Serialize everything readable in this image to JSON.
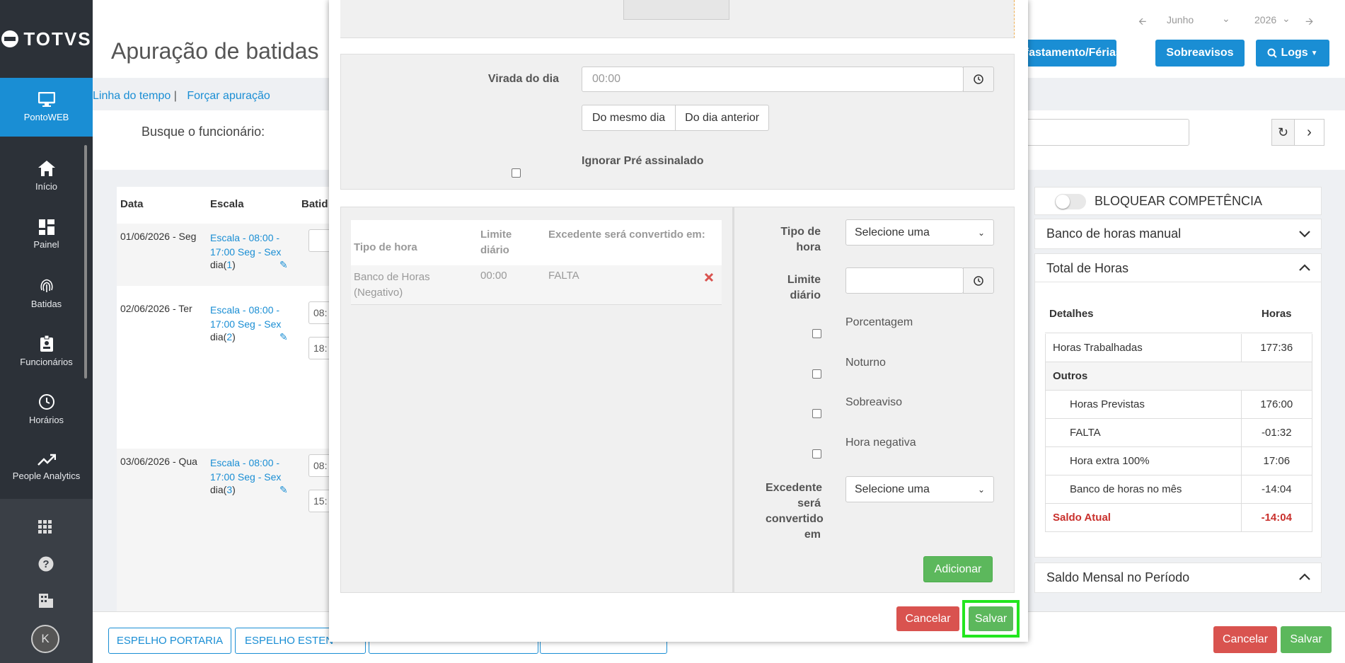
{
  "sidebar": {
    "brand": "TOTVS",
    "items": [
      {
        "label": "PontoWEB",
        "icon": "monitor-icon"
      },
      {
        "label": "Início",
        "icon": "home-icon"
      },
      {
        "label": "Painel",
        "icon": "dashboard-icon"
      },
      {
        "label": "Batidas",
        "icon": "fingerprint-icon"
      },
      {
        "label": "Funcionários",
        "icon": "badge-icon"
      },
      {
        "label": "Horários",
        "icon": "clock-icon"
      },
      {
        "label": "People Analytics",
        "icon": "trend-icon"
      }
    ],
    "avatar": "K"
  },
  "header": {
    "title": "Apuração de batidas",
    "month": "Junho",
    "year": "2026",
    "btn_afastamento": "Afastamento/Férias",
    "btn_sobreavisos": "Sobreavisos",
    "btn_logs": "Logs",
    "link_timeline": "Linha do tempo",
    "link_forcar": "Forçar apuração",
    "search_label": "Busque o funcionário:"
  },
  "table": {
    "headers": [
      "Data",
      "Escala",
      "Batid"
    ],
    "rows": [
      {
        "date": "01/06/2026 - Seg",
        "escala": "Escala - 08:00 - 17:00 Seg - Sex",
        "dia_pre": "dia(",
        "dia_num": "1",
        "dia_post": ")",
        "b1": "",
        "b2": ""
      },
      {
        "date": "02/06/2026 - Ter",
        "escala": "Escala - 08:00 - 17:00 Seg - Sex",
        "dia_pre": "dia(",
        "dia_num": "2",
        "dia_post": ")",
        "b1": "08:",
        "b2": "18:"
      },
      {
        "date": "03/06/2026 - Qua",
        "escala": "Escala - 08:00 - 17:00 Seg - Sex",
        "dia_pre": "dia(",
        "dia_num": "3",
        "dia_post": ")",
        "b1": "08:",
        "b2": "15:"
      }
    ]
  },
  "right": {
    "bloquear": "BLOQUEAR COMPETÊNCIA",
    "banco_manual": "Banco de horas manual",
    "total_horas": "Total de Horas",
    "col_detalhes": "Detalhes",
    "col_horas": "Horas",
    "rows": [
      {
        "label": "Horas Trabalhadas",
        "value": "177:36"
      },
      {
        "label": "Outros",
        "value": ""
      },
      {
        "label": "Horas Previstas",
        "value": "176:00"
      },
      {
        "label": "FALTA",
        "value": "-01:32"
      },
      {
        "label": "Hora extra 100%",
        "value": "17:06"
      },
      {
        "label": "Banco de horas no mês",
        "value": "-14:04"
      },
      {
        "label": "Saldo Atual",
        "value": "-14:04"
      }
    ],
    "saldo_mensal": "Saldo Mensal no Período"
  },
  "footer": {
    "btn1": "ESPELHO PORTARIA",
    "btn2": "ESPELHO ESTEN",
    "cancel": "Cancelar",
    "save": "Salvar"
  },
  "modal": {
    "virada_label": "Virada do dia",
    "virada_placeholder": "00:00",
    "opt_mesmo": "Do mesmo dia",
    "opt_anterior": "Do dia anterior",
    "ignorar": "Ignorar Pré assinalado",
    "grid_headers": [
      "Tipo de hora",
      "Limite diário",
      "Excedente será convertido em:"
    ],
    "grid_row": {
      "tipo": "Banco de Horas (Negativo)",
      "limite": "00:00",
      "excedente": "FALTA"
    },
    "form": {
      "tipo_label": "Tipo de hora",
      "tipo_value": "Selecione uma",
      "limite_label": "Limite diário",
      "porcentagem": "Porcentagem",
      "noturno": "Noturno",
      "sobreaviso": "Sobreaviso",
      "hora_negativa": "Hora negativa",
      "excedente_label": "Excedente será convertido em",
      "excedente_value": "Selecione uma",
      "adicionar": "Adicionar"
    },
    "cancel": "Cancelar",
    "save": "Salvar"
  },
  "colors": {
    "primary": "#1a8ed4",
    "danger": "#d9534f",
    "success": "#5cb85c",
    "sidebar": "#2c3138",
    "highlight": "#22e61e"
  }
}
